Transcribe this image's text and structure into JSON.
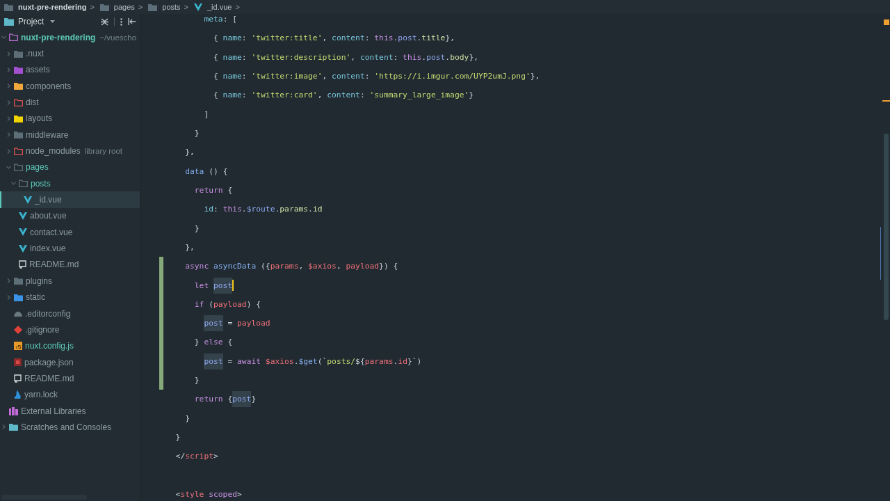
{
  "breadcrumb": [
    {
      "label": "nuxt-pre-rendering",
      "kind": "folder",
      "separator": ">"
    },
    {
      "label": "pages",
      "kind": "folder",
      "separator": ">"
    },
    {
      "label": "posts",
      "kind": "folder",
      "separator": ">"
    },
    {
      "label": "_id.vue",
      "kind": "vue",
      "separator": ">"
    }
  ],
  "project_panel": {
    "title": "Project",
    "tree": [
      {
        "label": "nuxt-pre-rendering",
        "suffix": "~/vuescho",
        "kind": "project",
        "expanded": true,
        "modified": true,
        "selected": false,
        "children": [
          {
            "label": ".nuxt",
            "kind": "folder",
            "expanded": false,
            "modified": false,
            "selected": false
          },
          {
            "label": "assets",
            "kind": "folder-assets",
            "expanded": false,
            "modified": false,
            "selected": false
          },
          {
            "label": "components",
            "kind": "folder-components",
            "expanded": false,
            "modified": false,
            "selected": false
          },
          {
            "label": "dist",
            "kind": "folder-excluded",
            "expanded": false,
            "modified": false,
            "selected": false
          },
          {
            "label": "layouts",
            "kind": "folder-layouts",
            "expanded": false,
            "modified": false,
            "selected": false
          },
          {
            "label": "middleware",
            "kind": "folder",
            "expanded": false,
            "modified": false,
            "selected": false
          },
          {
            "label": "node_modules",
            "suffix": "library root",
            "kind": "folder-excluded",
            "expanded": false,
            "modified": false,
            "selected": false
          },
          {
            "label": "pages",
            "kind": "folder-open",
            "expanded": true,
            "modified": true,
            "selected": false,
            "children": [
              {
                "label": "posts",
                "kind": "folder-open",
                "expanded": true,
                "modified": true,
                "selected": false,
                "children": [
                  {
                    "label": "_id.vue",
                    "kind": "vue",
                    "modified": false,
                    "selected": true
                  }
                ]
              },
              {
                "label": "about.vue",
                "kind": "vue",
                "modified": false,
                "selected": false
              },
              {
                "label": "contact.vue",
                "kind": "vue",
                "modified": false,
                "selected": false
              },
              {
                "label": "index.vue",
                "kind": "vue",
                "modified": false,
                "selected": false
              },
              {
                "label": "README.md",
                "kind": "readme",
                "modified": false,
                "selected": false
              }
            ]
          },
          {
            "label": "plugins",
            "kind": "folder",
            "expanded": false,
            "modified": false,
            "selected": false
          },
          {
            "label": "static",
            "kind": "folder-static",
            "expanded": false,
            "modified": false,
            "selected": false
          },
          {
            "label": ".editorconfig",
            "kind": "editorconfig",
            "modified": false,
            "selected": false
          },
          {
            "label": ".gitignore",
            "kind": "git",
            "modified": false,
            "selected": false
          },
          {
            "label": "nuxt.config.js",
            "kind": "js",
            "modified": true,
            "selected": false
          },
          {
            "label": "package.json",
            "kind": "npm",
            "modified": false,
            "selected": false
          },
          {
            "label": "README.md",
            "kind": "readme",
            "modified": false,
            "selected": false
          },
          {
            "label": "yarn.lock",
            "kind": "yarn",
            "modified": false,
            "selected": false
          }
        ]
      },
      {
        "label": "External Libraries",
        "kind": "libraries",
        "modified": false,
        "selected": false
      },
      {
        "label": "Scratches and Consoles",
        "kind": "scratches",
        "expanded": false,
        "modified": false,
        "selected": false
      }
    ]
  },
  "editor": {
    "lines": [
      {
        "kind": "code",
        "changed": false,
        "caret": false,
        "tokens": [
          {
            "text": "meta",
            "kind": "key"
          },
          {
            "text": ": [",
            "kind": "punct"
          }
        ]
      },
      {
        "kind": "code",
        "changed": false,
        "caret": false,
        "tokens": [
          {
            "text": "{ ",
            "kind": "punct"
          },
          {
            "text": "name",
            "kind": "key"
          },
          {
            "text": ": ",
            "kind": "punct"
          },
          {
            "text": "'twitter:title'",
            "kind": "str"
          },
          {
            "text": ", ",
            "kind": "punct"
          },
          {
            "text": "content",
            "kind": "key"
          },
          {
            "text": ": ",
            "kind": "punct"
          },
          {
            "text": "this",
            "kind": "this"
          },
          {
            "text": ".",
            "kind": "punct"
          },
          {
            "text": "post",
            "kind": "member"
          },
          {
            "text": ".",
            "kind": "punct"
          },
          {
            "text": "title",
            "kind": "field"
          },
          {
            "text": "},",
            "kind": "punct"
          }
        ]
      },
      {
        "kind": "code",
        "changed": false,
        "caret": false,
        "tokens": [
          {
            "text": "{ ",
            "kind": "punct"
          },
          {
            "text": "name",
            "kind": "key"
          },
          {
            "text": ": ",
            "kind": "punct"
          },
          {
            "text": "'twitter:description'",
            "kind": "str"
          },
          {
            "text": ", ",
            "kind": "punct"
          },
          {
            "text": "content",
            "kind": "key"
          },
          {
            "text": ": ",
            "kind": "punct"
          },
          {
            "text": "this",
            "kind": "this"
          },
          {
            "text": ".",
            "kind": "punct"
          },
          {
            "text": "post",
            "kind": "member"
          },
          {
            "text": ".",
            "kind": "punct"
          },
          {
            "text": "body",
            "kind": "field"
          },
          {
            "text": "},",
            "kind": "punct"
          }
        ]
      },
      {
        "kind": "code",
        "changed": false,
        "caret": false,
        "tokens": [
          {
            "text": "{ ",
            "kind": "punct"
          },
          {
            "text": "name",
            "kind": "key"
          },
          {
            "text": ": ",
            "kind": "punct"
          },
          {
            "text": "'twitter:image'",
            "kind": "str"
          },
          {
            "text": ", ",
            "kind": "punct"
          },
          {
            "text": "content",
            "kind": "key"
          },
          {
            "text": ": ",
            "kind": "punct"
          },
          {
            "text": "'https://i.imgur.com/UYP2umJ.png'",
            "kind": "str"
          },
          {
            "text": "},",
            "kind": "punct"
          }
        ]
      },
      {
        "kind": "code",
        "changed": false,
        "caret": false,
        "tokens": [
          {
            "text": "{ ",
            "kind": "punct"
          },
          {
            "text": "name",
            "kind": "key"
          },
          {
            "text": ": ",
            "kind": "punct"
          },
          {
            "text": "'twitter:card'",
            "kind": "str"
          },
          {
            "text": ", ",
            "kind": "punct"
          },
          {
            "text": "content",
            "kind": "key"
          },
          {
            "text": ": ",
            "kind": "punct"
          },
          {
            "text": "'summary_large_image'",
            "kind": "str"
          },
          {
            "text": "}",
            "kind": "punct"
          }
        ]
      },
      {
        "kind": "code",
        "changed": false,
        "caret": false,
        "tokens": [
          {
            "text": "]",
            "kind": "punct"
          }
        ]
      },
      {
        "kind": "code",
        "changed": false,
        "caret": false,
        "tokens": [
          {
            "text": "}",
            "kind": "punct"
          }
        ]
      },
      {
        "kind": "code",
        "changed": false,
        "caret": false,
        "tokens": [
          {
            "text": "},",
            "kind": "punct"
          }
        ]
      },
      {
        "kind": "code",
        "changed": false,
        "caret": false,
        "tokens": [
          {
            "text": "data",
            "kind": "fn"
          },
          {
            "text": " () {",
            "kind": "punct"
          }
        ]
      },
      {
        "kind": "code",
        "changed": false,
        "caret": false,
        "tokens": [
          {
            "text": "return",
            "kind": "kw"
          },
          {
            "text": " {",
            "kind": "punct"
          }
        ]
      },
      {
        "kind": "code",
        "changed": false,
        "caret": false,
        "tokens": [
          {
            "text": "id",
            "kind": "key"
          },
          {
            "text": ": ",
            "kind": "punct"
          },
          {
            "text": "this",
            "kind": "this"
          },
          {
            "text": ".",
            "kind": "punct"
          },
          {
            "text": "$route",
            "kind": "member"
          },
          {
            "text": ".",
            "kind": "punct"
          },
          {
            "text": "params",
            "kind": "field"
          },
          {
            "text": ".",
            "kind": "punct"
          },
          {
            "text": "id",
            "kind": "field"
          }
        ]
      },
      {
        "kind": "code",
        "changed": false,
        "caret": false,
        "tokens": [
          {
            "text": "}",
            "kind": "punct"
          }
        ]
      },
      {
        "kind": "code",
        "changed": false,
        "caret": false,
        "tokens": [
          {
            "text": "},",
            "kind": "punct"
          }
        ]
      },
      {
        "kind": "code",
        "changed": true,
        "caret": false,
        "tokens": [
          {
            "text": "async ",
            "kind": "kw"
          },
          {
            "text": "asyncData",
            "kind": "fn"
          },
          {
            "text": " ({",
            "kind": "punct"
          },
          {
            "text": "params",
            "kind": "var"
          },
          {
            "text": ", ",
            "kind": "punct"
          },
          {
            "text": "$axios",
            "kind": "var"
          },
          {
            "text": ", ",
            "kind": "punct"
          },
          {
            "text": "payload",
            "kind": "var"
          },
          {
            "text": "}) {",
            "kind": "punct"
          }
        ]
      },
      {
        "kind": "code",
        "changed": true,
        "caret": true,
        "tokens": [
          {
            "text": "let ",
            "kind": "kw"
          },
          {
            "text": "post",
            "kind": "occurrence"
          }
        ]
      },
      {
        "kind": "code",
        "changed": true,
        "caret": false,
        "tokens": [
          {
            "text": "if",
            "kind": "kw"
          },
          {
            "text": " (",
            "kind": "punct"
          },
          {
            "text": "payload",
            "kind": "var"
          },
          {
            "text": ") {",
            "kind": "punct"
          }
        ]
      },
      {
        "kind": "code",
        "changed": true,
        "caret": false,
        "tokens": [
          {
            "text": "post",
            "kind": "occurrence"
          },
          {
            "text": " = ",
            "kind": "punct"
          },
          {
            "text": "payload",
            "kind": "var"
          }
        ]
      },
      {
        "kind": "code",
        "changed": true,
        "caret": false,
        "tokens": [
          {
            "text": "} ",
            "kind": "punct"
          },
          {
            "text": "else",
            "kind": "kw"
          },
          {
            "text": " {",
            "kind": "punct"
          }
        ]
      },
      {
        "kind": "code",
        "changed": true,
        "caret": false,
        "tokens": [
          {
            "text": "post",
            "kind": "occurrence"
          },
          {
            "text": " = ",
            "kind": "punct"
          },
          {
            "text": "await ",
            "kind": "kw"
          },
          {
            "text": "$axios",
            "kind": "var"
          },
          {
            "text": ".",
            "kind": "punct"
          },
          {
            "text": "$get",
            "kind": "fn"
          },
          {
            "text": "(`",
            "kind": "punct"
          },
          {
            "text": "posts/",
            "kind": "str"
          },
          {
            "text": "${",
            "kind": "punct"
          },
          {
            "text": "params",
            "kind": "var"
          },
          {
            "text": ".",
            "kind": "punct"
          },
          {
            "text": "id",
            "kind": "var"
          },
          {
            "text": "}`)",
            "kind": "punct"
          }
        ]
      },
      {
        "kind": "code",
        "changed": true,
        "caret": false,
        "tokens": [
          {
            "text": "}",
            "kind": "punct"
          }
        ]
      },
      {
        "kind": "code",
        "changed": false,
        "caret": false,
        "tokens": [
          {
            "text": "return",
            "kind": "kw"
          },
          {
            "text": " {",
            "kind": "punct"
          },
          {
            "text": "post",
            "kind": "occurrence"
          },
          {
            "text": "}",
            "kind": "punct"
          }
        ]
      },
      {
        "kind": "code",
        "changed": false,
        "caret": false,
        "tokens": [
          {
            "text": "}",
            "kind": "punct"
          }
        ]
      },
      {
        "kind": "code",
        "changed": false,
        "caret": false,
        "tokens": [
          {
            "text": "}",
            "kind": "punct"
          }
        ]
      },
      {
        "kind": "code",
        "changed": false,
        "caret": false,
        "tokens": [
          {
            "text": "</",
            "kind": "punct"
          },
          {
            "text": "script",
            "kind": "tag"
          },
          {
            "text": ">",
            "kind": "punct"
          }
        ]
      },
      {
        "kind": "blank"
      },
      {
        "kind": "code",
        "changed": false,
        "caret": false,
        "tokens": [
          {
            "text": "<",
            "kind": "punct"
          },
          {
            "text": "style ",
            "kind": "tag"
          },
          {
            "text": "scoped",
            "kind": "attr"
          },
          {
            "text": ">",
            "kind": "punct"
          }
        ]
      }
    ]
  }
}
